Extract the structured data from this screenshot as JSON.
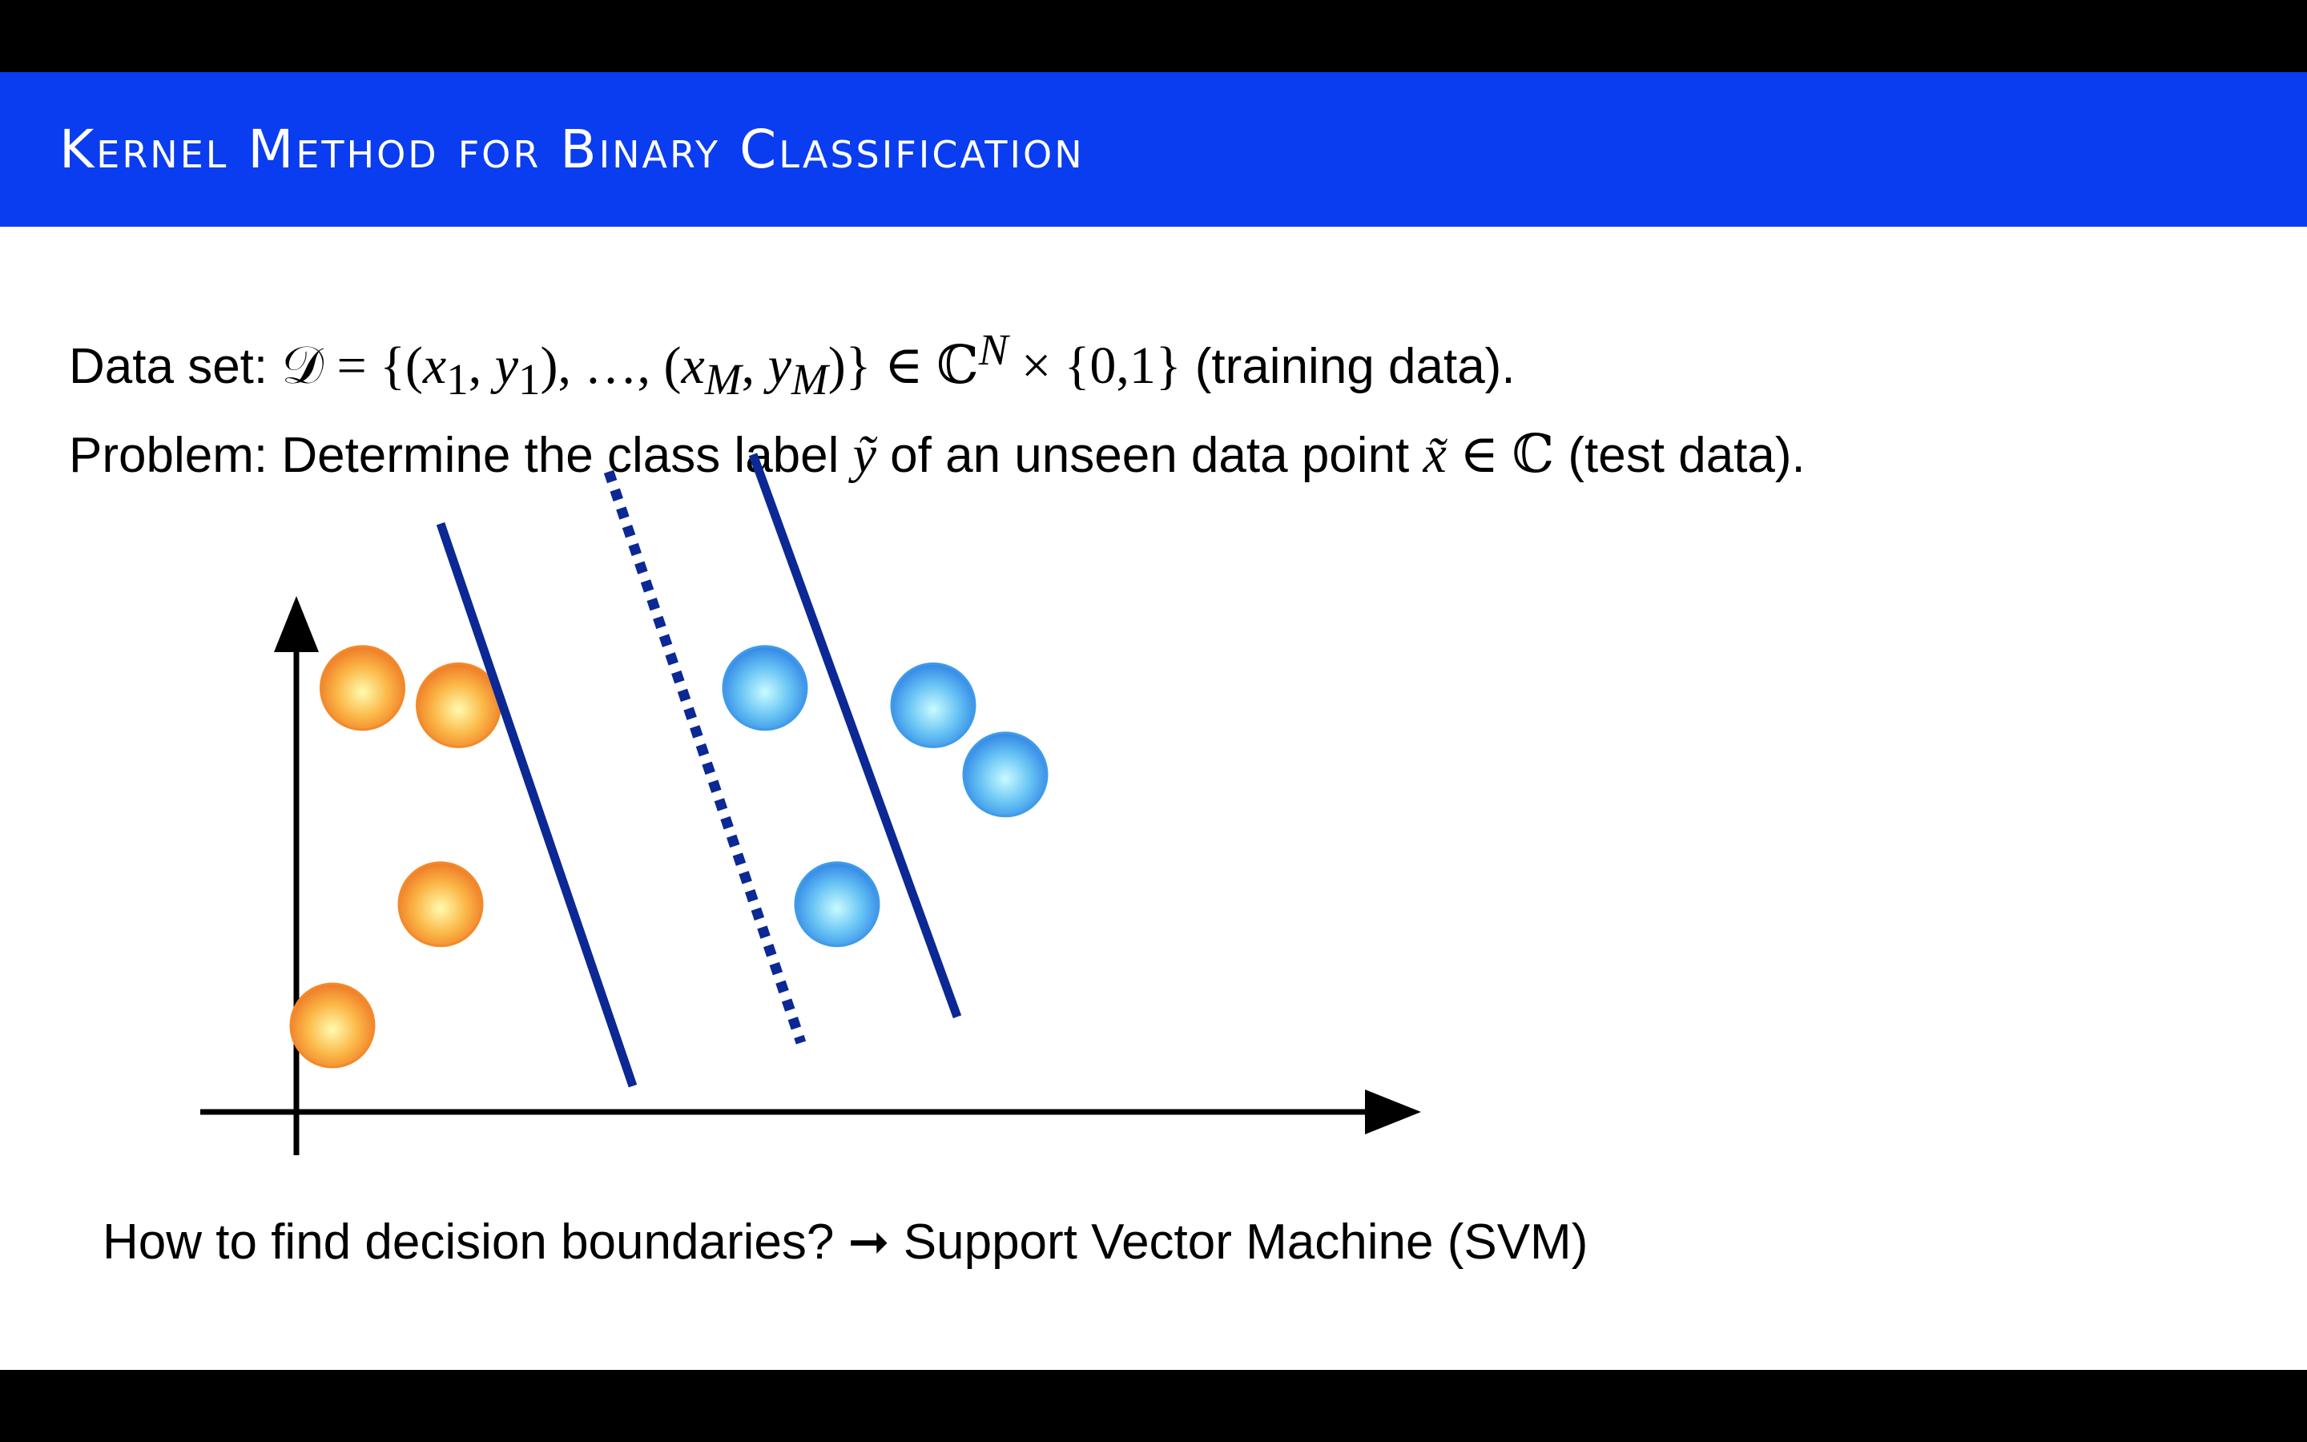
{
  "colors": {
    "title_bar": "#0a3cf0",
    "title_text": "#ffffff",
    "boundary": "#0b2894",
    "class0": "#f28a2a",
    "class1": "#3f9be9",
    "axis": "#000000"
  },
  "slide": {
    "title": "Kernel Method for Binary Classification",
    "dataset": {
      "label": "Data set:",
      "formula_D": "𝒟",
      "formula_eq": " = {(",
      "x1": "x",
      "sub1": "1",
      "comma1": ", ",
      "y1": "y",
      "sub2": "1",
      "mid": "), …, (",
      "xM": "x",
      "subM1": "M",
      "comma2": ", ",
      "yM": "y",
      "subM2": "M",
      "close": ")} ∈ ℂ",
      "supN": "N",
      "times": " × {0,1}",
      "note": " (training data)."
    },
    "problem": {
      "label": "Problem: Determine the class label ",
      "ytilde": "ỹ",
      "middle": " of an unseen data point ",
      "xtilde": "x̃",
      "in_c": " ∈ ℂ",
      "note": " (test data)."
    },
    "footer": {
      "question": "How to find decision boundaries? ",
      "arrow": "➞",
      "answer": " Support Vector Machine (SVM)"
    }
  },
  "chart_data": {
    "type": "scatter",
    "title": "",
    "xlabel": "",
    "ylabel": "",
    "grid": false,
    "axes": "arrows, no ticks",
    "series": [
      {
        "class": "class 0 (orange)",
        "points": [
          [
            0.55,
            4.9
          ],
          [
            1.35,
            4.7
          ],
          [
            1.2,
            2.4
          ],
          [
            0.3,
            1.0
          ]
        ]
      },
      {
        "class": "class 1 (blue)",
        "points": [
          [
            3.9,
            4.9
          ],
          [
            5.3,
            4.7
          ],
          [
            5.9,
            3.9
          ],
          [
            4.5,
            2.4
          ]
        ]
      }
    ],
    "lines": [
      {
        "kind": "margin-boundary",
        "style": "solid",
        "points": [
          [
            1.2,
            6.8
          ],
          [
            2.8,
            0.3
          ]
        ]
      },
      {
        "kind": "decision-boundary",
        "style": "dotted",
        "points": [
          [
            2.6,
            7.4
          ],
          [
            4.2,
            0.8
          ]
        ]
      },
      {
        "kind": "margin-boundary",
        "style": "solid",
        "points": [
          [
            3.8,
            7.6
          ],
          [
            5.5,
            1.1
          ]
        ]
      }
    ]
  }
}
